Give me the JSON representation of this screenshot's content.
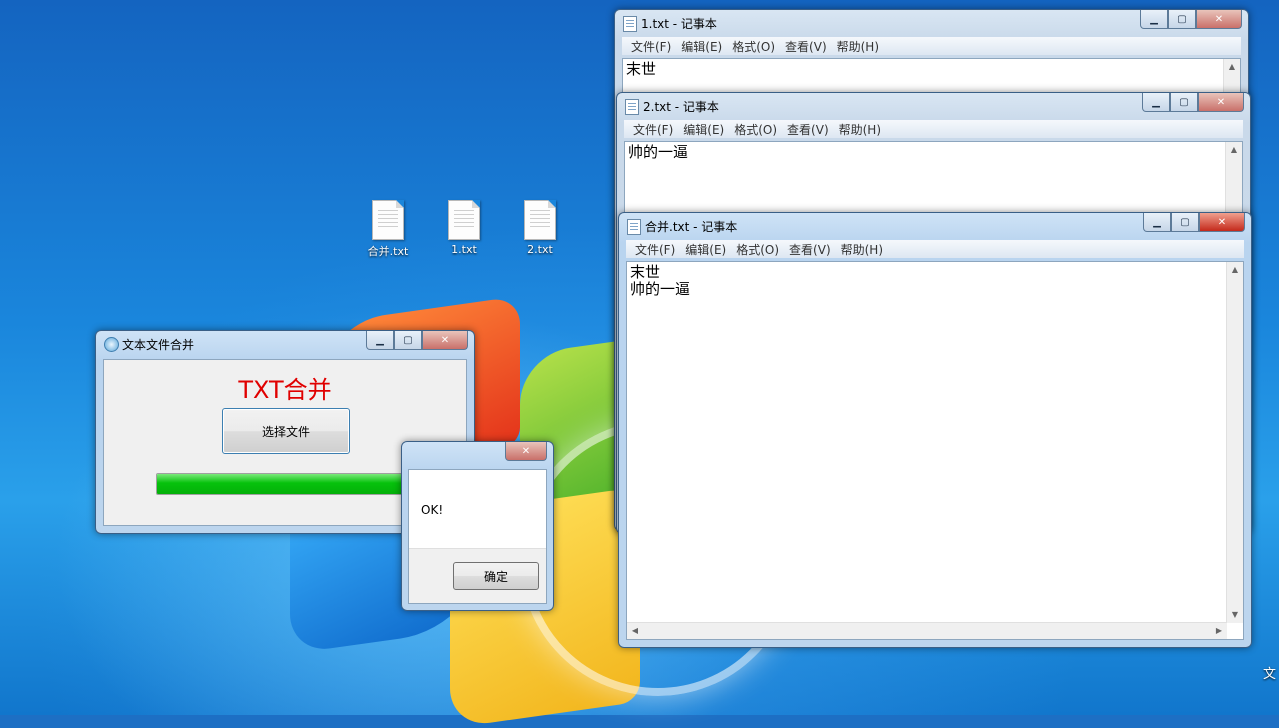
{
  "desktop": {
    "icons": [
      {
        "label": "合并.txt"
      },
      {
        "label": "1.txt"
      },
      {
        "label": "2.txt"
      }
    ],
    "corner_text": "文"
  },
  "notepad1": {
    "title": "1.txt - 记事本",
    "menu": [
      "文件(F)",
      "编辑(E)",
      "格式(O)",
      "查看(V)",
      "帮助(H)"
    ],
    "content": "末世"
  },
  "notepad2": {
    "title": "2.txt - 记事本",
    "menu": [
      "文件(F)",
      "编辑(E)",
      "格式(O)",
      "查看(V)",
      "帮助(H)"
    ],
    "content": "帅的一逼"
  },
  "notepad_merged": {
    "title": "合并.txt - 记事本",
    "menu": [
      "文件(F)",
      "编辑(E)",
      "格式(O)",
      "查看(V)",
      "帮助(H)"
    ],
    "content": "末世\n帅的一逼"
  },
  "merge_app": {
    "title": "文本文件合并",
    "heading": "TXT合并",
    "select_button": "选择文件",
    "progress": 1.0,
    "progress_color": "#06c20c",
    "heading_color": "#e00000"
  },
  "message_box": {
    "text": "OK!",
    "ok_button": "确定"
  },
  "icons": {
    "minimize": "minimize-icon",
    "maximize": "maximize-icon",
    "close": "close-icon"
  }
}
